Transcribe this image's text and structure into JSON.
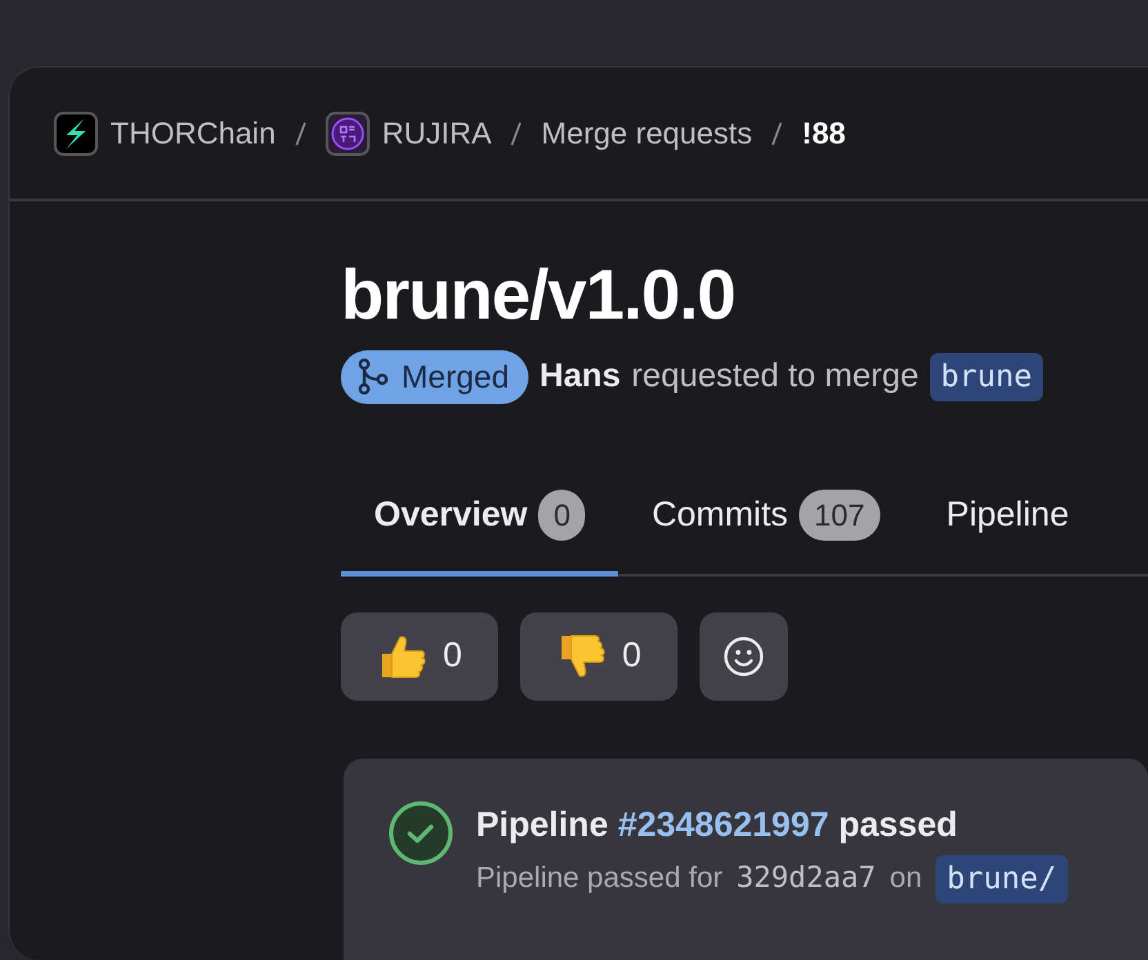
{
  "breadcrumb": [
    {
      "label": "THORChain",
      "kind": "project"
    },
    {
      "label": "RUJIRA",
      "kind": "project"
    },
    {
      "label": "Merge requests",
      "kind": "link"
    },
    {
      "label": "!88",
      "kind": "current"
    }
  ],
  "title": "brune/v1.0.0",
  "status": {
    "badge": "Merged",
    "author": "Hans",
    "text": "requested to merge",
    "branch": "brune"
  },
  "tabs": [
    {
      "label": "Overview",
      "count": "0",
      "selected": true
    },
    {
      "label": "Commits",
      "count": "107",
      "selected": false
    },
    {
      "label": "Pipeline",
      "selected": false
    }
  ],
  "reactions": [
    {
      "kind": "thumbsup",
      "count": "0"
    },
    {
      "kind": "thumbsdown",
      "count": "0"
    },
    {
      "kind": "add"
    }
  ],
  "pipeline": {
    "title_start": "Pipeline",
    "link": "#2348621997",
    "title_end": "passed",
    "detail": "Pipeline passed for",
    "commit": "329d2aa7",
    "on": "on",
    "branch": "brune/"
  }
}
